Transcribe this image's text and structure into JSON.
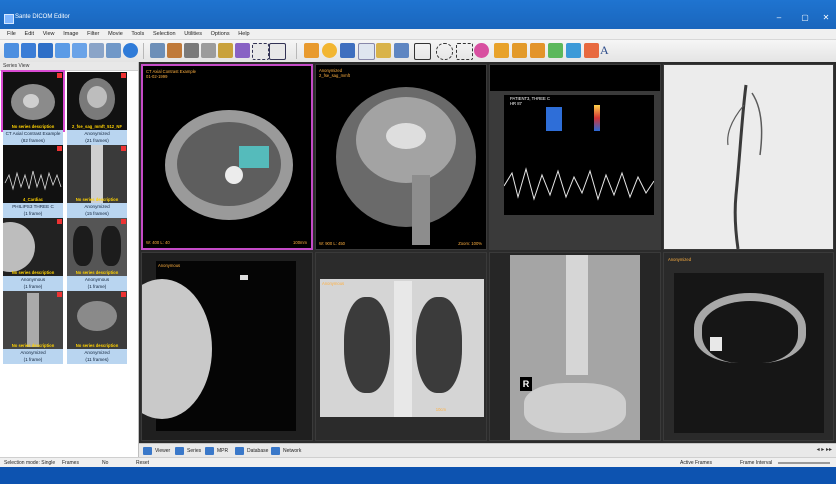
{
  "window": {
    "title": "Sante DICOM Editor"
  },
  "menu": [
    "File",
    "Edit",
    "View",
    "Image",
    "Filter",
    "Movie",
    "Tools",
    "Selection",
    "Utilities",
    "Options",
    "Help"
  ],
  "series_panel": {
    "header": "Series View",
    "thumbs": [
      {
        "desc": "No series description",
        "name": "CT Axial Contrast Example",
        "frames": "(82 frames)"
      },
      {
        "desc": "2_fse_sag_mmft_512_NF",
        "name": "Anonymized",
        "frames": "(21 frames)"
      },
      {
        "desc": "4_Cardiac",
        "name": "PHILIPS3 THREE C",
        "frames": "(1 frame)"
      },
      {
        "desc": "No series description",
        "name": "Anonymized",
        "frames": "(15 frames)"
      },
      {
        "desc": "No series description",
        "name": "Anonymous",
        "frames": "(1 frame)"
      },
      {
        "desc": "No series description",
        "name": "Anonymous",
        "frames": "(1 frame)"
      },
      {
        "desc": "No series description",
        "name": "Anonymized",
        "frames": "(1 frame)"
      },
      {
        "desc": "No series description",
        "name": "Anonymized",
        "frames": "(11 frames)"
      }
    ]
  },
  "viewports": [
    {
      "tl": "CT Axial Contrast Example",
      "tl2": "01-02-1999",
      "bl": "W: 400 L: 40",
      "br": "100mm"
    },
    {
      "tl": "Anonymized",
      "tl2": "2_fse_sag_mmft",
      "bl": "W: 900 L: 450",
      "br": "Zoom: 100%"
    },
    {
      "tl": "PATIENT3, THREE C",
      "tl2": "HR 87",
      "bl": "",
      "br": ""
    },
    {
      "tl": "",
      "tl2": "",
      "bl": "",
      "br": ""
    },
    {
      "tl": "Anonymous",
      "tl2": "",
      "bl": "",
      "br": ""
    },
    {
      "tl": "Anonymous",
      "tl2": "",
      "bl": "",
      "br": "10cm"
    },
    {
      "tl": "",
      "tl2": "",
      "bl": "",
      "br": ""
    },
    {
      "tl": "Anonymized",
      "tl2": "",
      "bl": "",
      "br": ""
    }
  ],
  "tabs": [
    "Viewer",
    "Series",
    "MPR",
    "Database",
    "Network"
  ],
  "status": {
    "mode": "Selection mode: Single",
    "frames_label": "Frames",
    "no_label": "No",
    "reset": "Reset",
    "active_frames": "Active Frames",
    "frame_interval": "Frame Interval"
  },
  "colors": {
    "accent": "#4a8cf0",
    "selected": "#c54bc7",
    "overlay": "#ffb040",
    "caption_bg": "#b9d5f0"
  }
}
